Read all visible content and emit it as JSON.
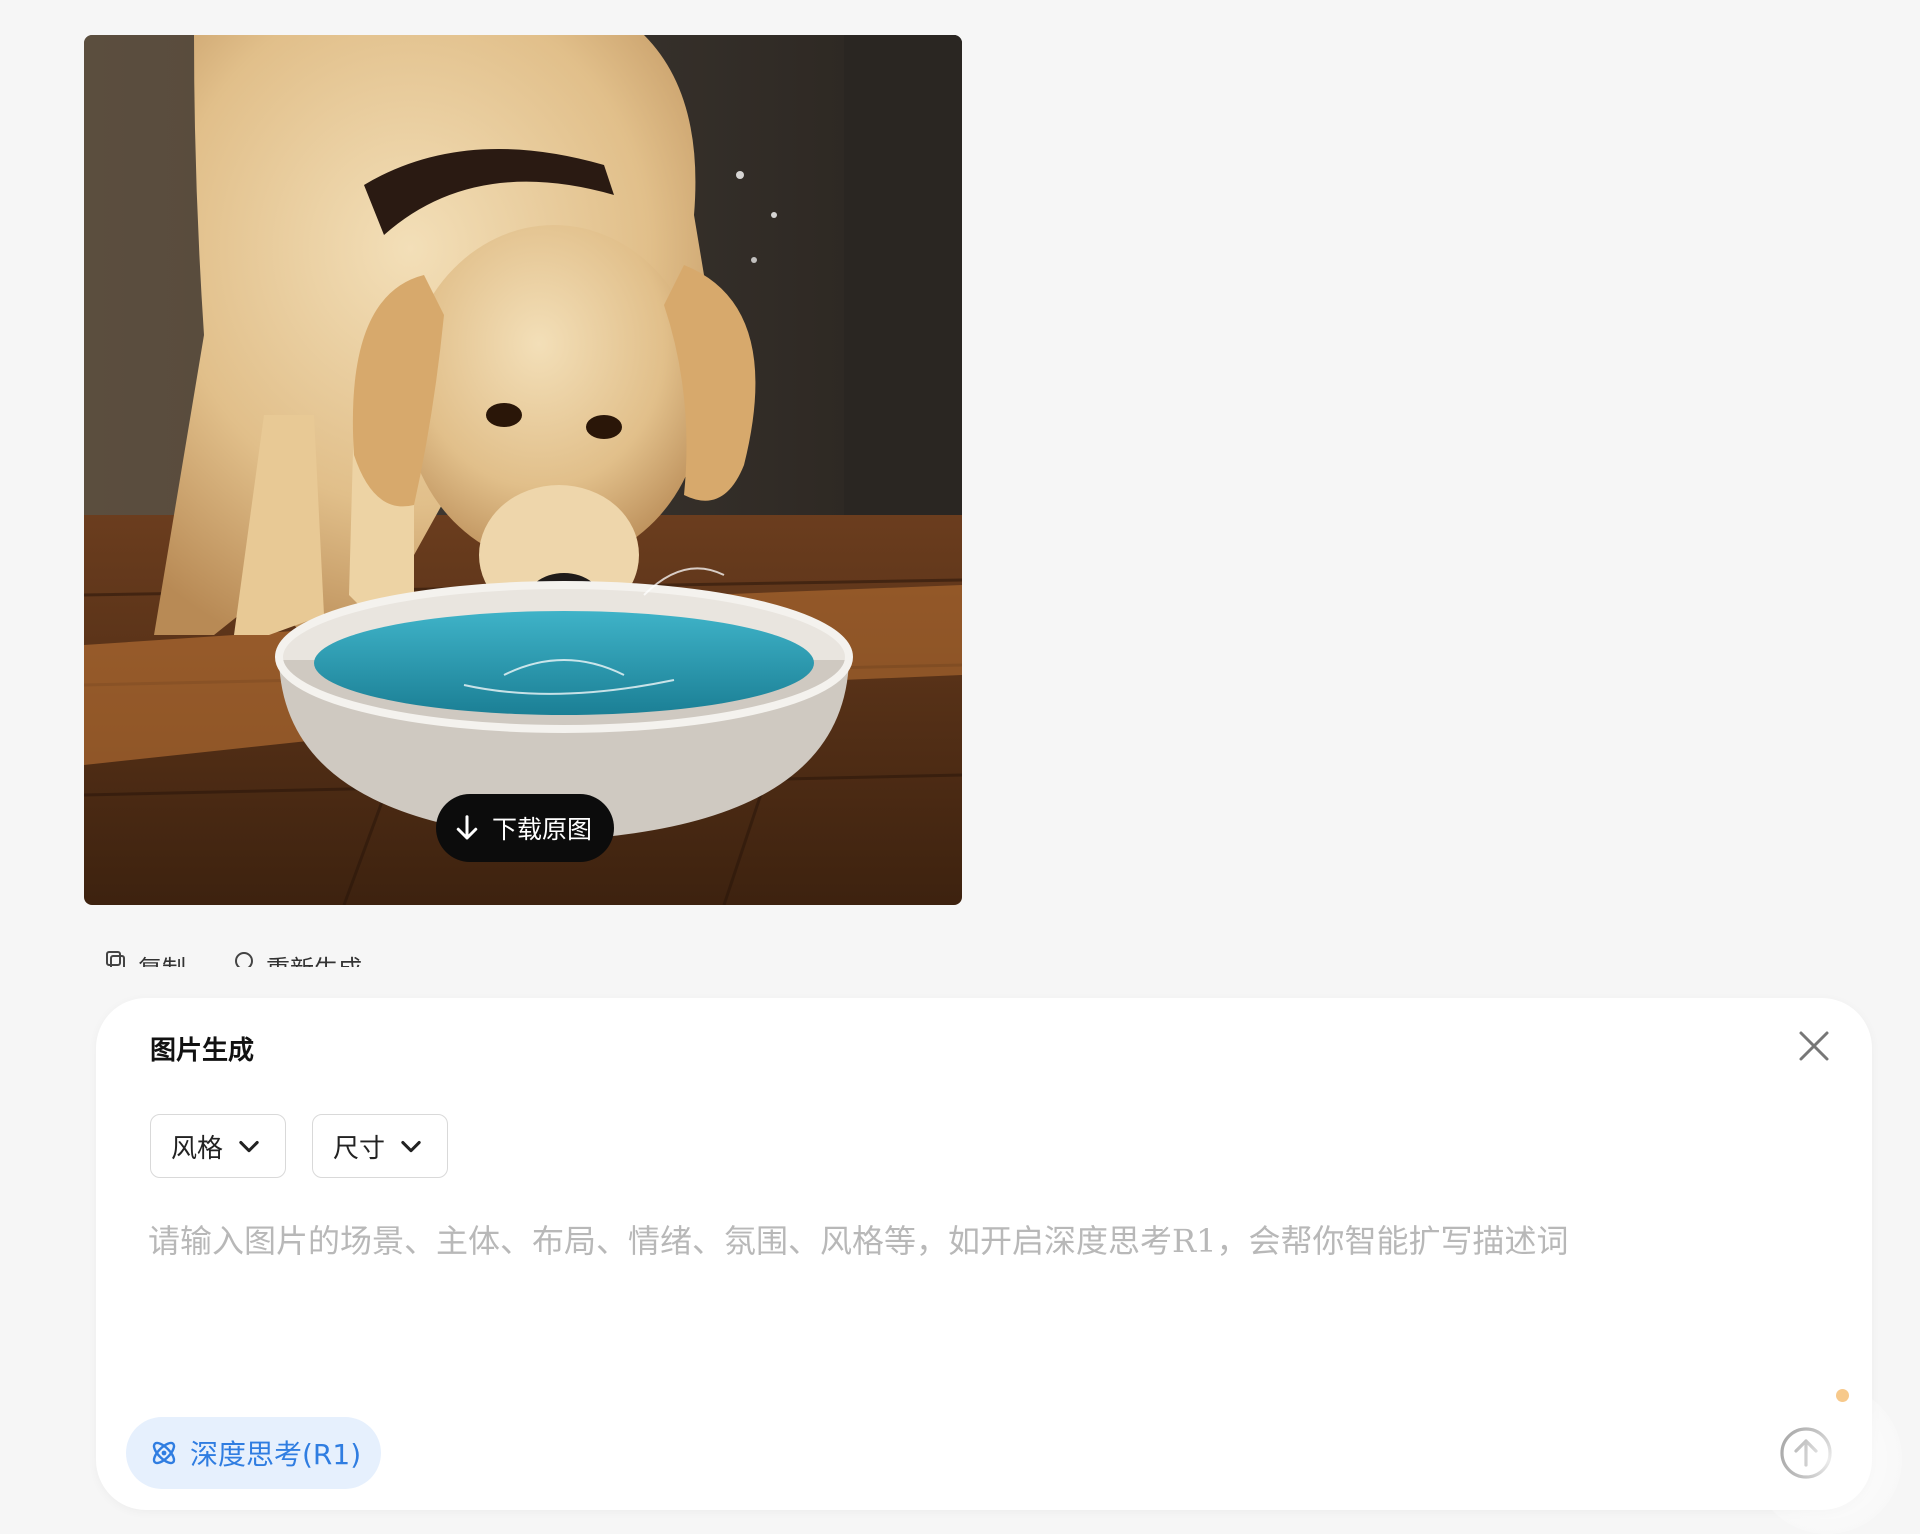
{
  "image": {
    "subject": "dog-drinking-from-bowl",
    "download_label": "下载原图"
  },
  "actions": {
    "copy_label": "复制",
    "regenerate_label": "重新生成"
  },
  "panel": {
    "title": "图片生成",
    "style_dropdown": "风格",
    "size_dropdown": "尺寸",
    "prompt_placeholder": "请输入图片的场景、主体、布局、情绪、氛围、风格等，如开启深度思考R1，会帮你智能扩写描述词",
    "prompt_value": "",
    "deep_think_label": "深度思考(R1)"
  },
  "colors": {
    "page_bg": "#f6f6f6",
    "panel_bg": "#ffffff",
    "accent_blue": "#2f7de1",
    "deep_think_bg": "#e6f0fd",
    "download_bg": "#0c0c0c"
  },
  "icons": [
    "download-arrow-icon",
    "copy-icon",
    "refresh-icon",
    "close-icon",
    "chevron-down-icon",
    "atom-icon",
    "arrow-up-circle-icon"
  ]
}
